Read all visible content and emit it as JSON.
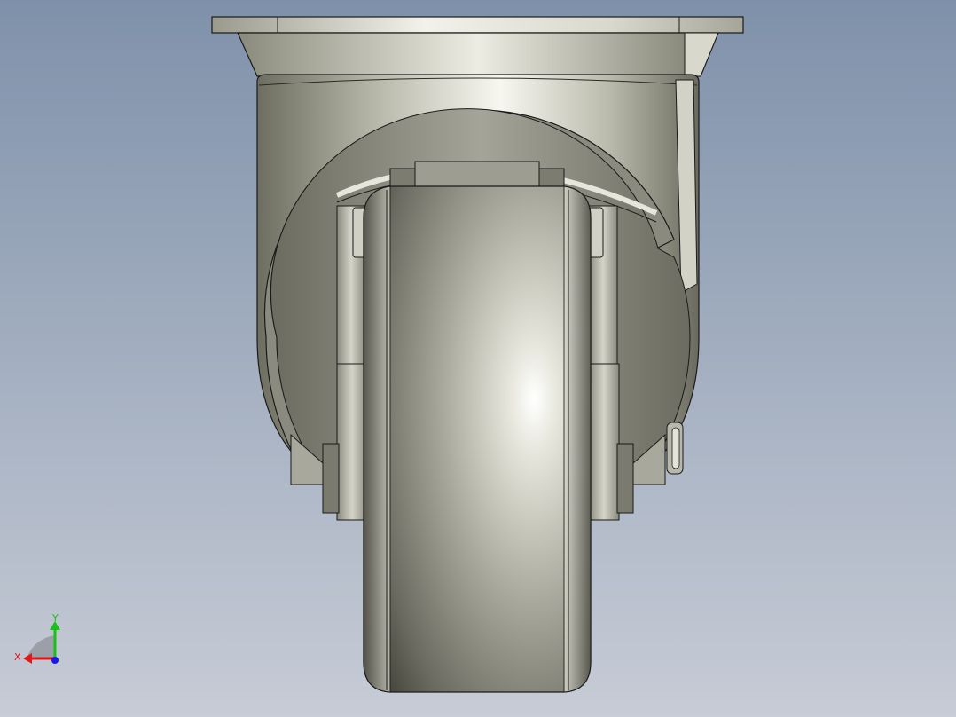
{
  "viewport": {
    "background_top": "#7f91aa",
    "background_bottom": "#c7ccd6"
  },
  "model": {
    "metal_light": "#f3f3ea",
    "metal_mid": "#b8b8aa",
    "metal_dark": "#5c5c52",
    "edge_color": "#1a1a1a"
  },
  "triad": {
    "x_label": "X",
    "y_label": "Y",
    "x_color": "#e01818",
    "y_color": "#18c018",
    "z_color": "#1818e0"
  }
}
